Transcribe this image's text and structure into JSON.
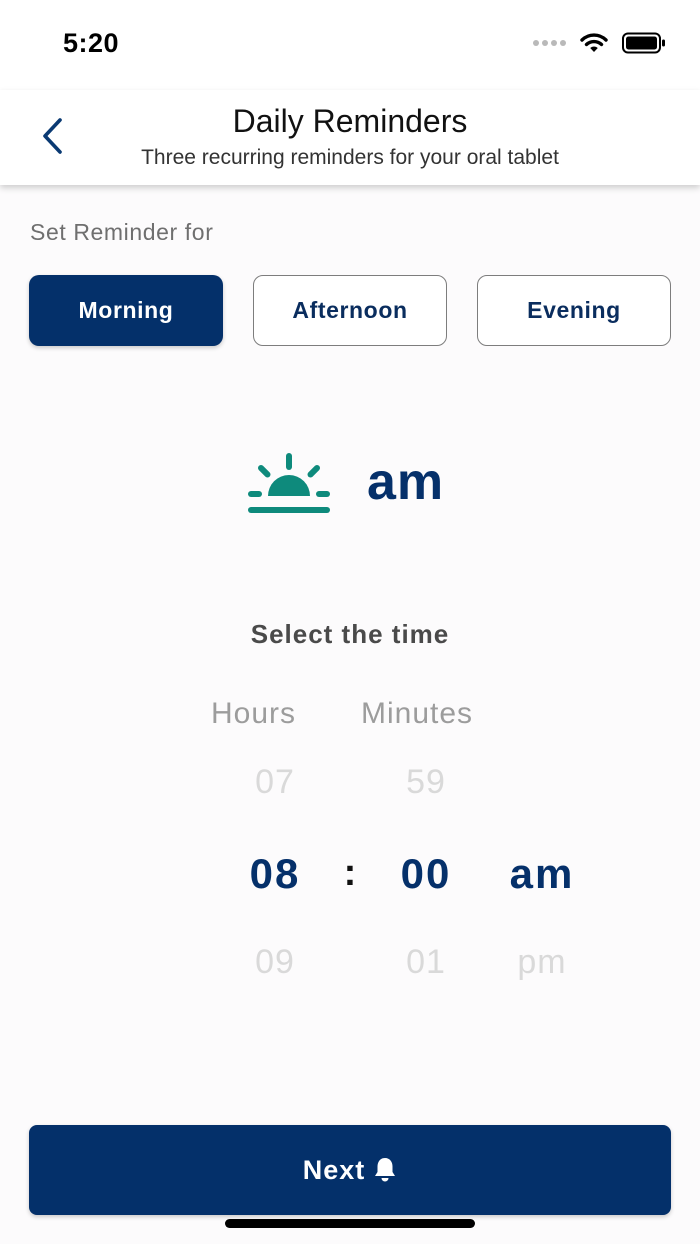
{
  "status_bar": {
    "time": "5:20"
  },
  "header": {
    "back_icon": "chevron-left-icon",
    "title": "Daily Reminders",
    "subtitle": "Three recurring reminders for your oral tablet"
  },
  "reminder": {
    "label": "Set Reminder for",
    "options": [
      "Morning",
      "Afternoon",
      "Evening"
    ],
    "selected": "Morning"
  },
  "period_display": {
    "icon": "sunrise-icon",
    "text": "am"
  },
  "time_picker": {
    "heading": "Select the time",
    "hours_label": "Hours",
    "minutes_label": "Minutes",
    "separator": ":",
    "hours": {
      "prev": "07",
      "selected": "08",
      "next": "09"
    },
    "minutes": {
      "prev": "59",
      "selected": "00",
      "next": "01"
    },
    "ampm": {
      "selected": "am",
      "next": "pm"
    }
  },
  "footer": {
    "next_label": "Next",
    "next_icon": "bell-icon"
  },
  "colors": {
    "primary": "#04306a",
    "accent": "#0e8a7c",
    "background": "#fcfbfc"
  }
}
